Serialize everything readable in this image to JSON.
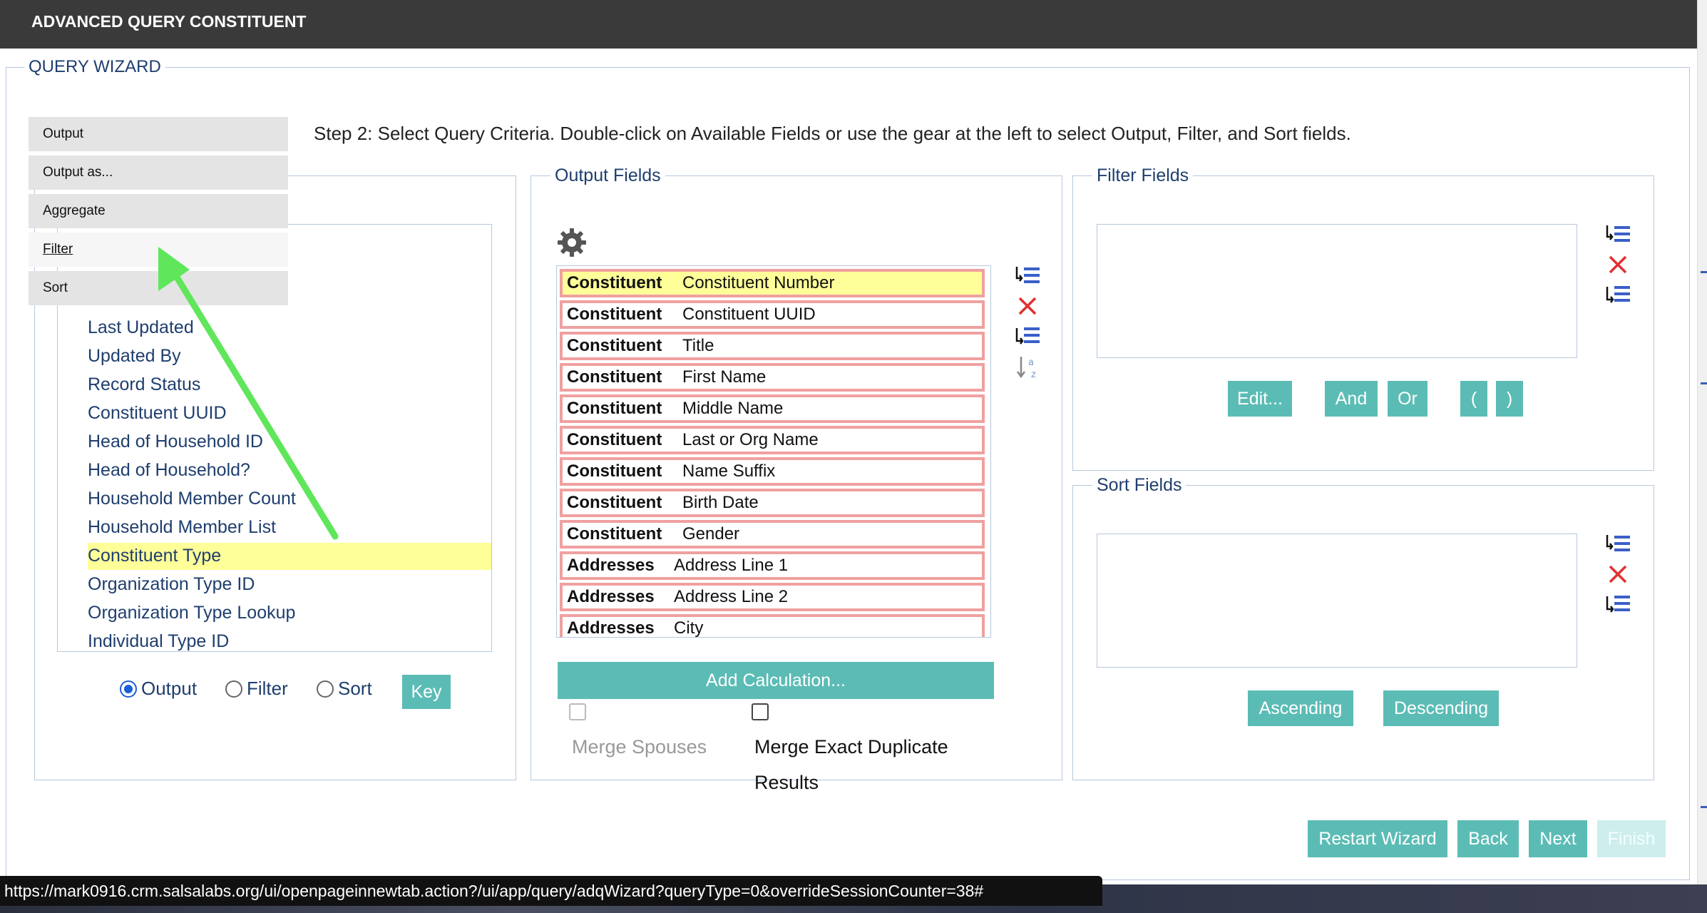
{
  "window": {
    "title": "ADVANCED QUERY CONSTITUENT"
  },
  "wizard": {
    "title": "QUERY WIZARD",
    "step_text": "Step 2: Select Query Criteria. Double-click on Available Fields or use the gear at the left to select Output, Filter, and Sort fields."
  },
  "context_menu": {
    "items": [
      "Output",
      "Output as...",
      "Aggregate",
      "Filter",
      "Sort"
    ],
    "hovered": "Filter"
  },
  "available_fields": {
    "items": [
      "Last Updated",
      "Updated By",
      "Record Status",
      "Constituent UUID",
      "Head of Household ID",
      "Head of Household?",
      "Household Member Count",
      "Household Member List",
      "Constituent Type",
      "Organization Type ID",
      "Organization Type Lookup",
      "Individual Type ID"
    ],
    "selected": "Constituent Type",
    "radio_options": [
      "Output",
      "Filter",
      "Sort"
    ],
    "radio_selected": "Output",
    "key_label": "Key"
  },
  "output_fields": {
    "title": "Output Fields",
    "rows": [
      {
        "category": "Constituent",
        "field": "Constituent Number"
      },
      {
        "category": "Constituent",
        "field": "Constituent UUID"
      },
      {
        "category": "Constituent",
        "field": "Title"
      },
      {
        "category": "Constituent",
        "field": "First Name"
      },
      {
        "category": "Constituent",
        "field": "Middle Name"
      },
      {
        "category": "Constituent",
        "field": "Last or Org Name"
      },
      {
        "category": "Constituent",
        "field": "Name Suffix"
      },
      {
        "category": "Constituent",
        "field": "Birth Date"
      },
      {
        "category": "Constituent",
        "field": "Gender"
      },
      {
        "category": "Addresses",
        "field": "Address Line 1"
      },
      {
        "category": "Addresses",
        "field": "Address Line 2"
      },
      {
        "category": "Addresses",
        "field": "City"
      }
    ],
    "add_calc_label": "Add Calculation...",
    "merge_spouses_label": "Merge Spouses",
    "merge_dupes_label_1": "Merge Exact Duplicate",
    "merge_dupes_label_2": "Results"
  },
  "filter_fields": {
    "title": "Filter Fields",
    "buttons": {
      "edit": "Edit...",
      "and": "And",
      "or": "Or",
      "open_paren": "(",
      "close_paren": ")"
    }
  },
  "sort_fields": {
    "title": "Sort Fields",
    "buttons": {
      "ascending": "Ascending",
      "descending": "Descending"
    }
  },
  "footer": {
    "restart": "Restart Wizard",
    "back": "Back",
    "next": "Next",
    "finish": "Finish"
  },
  "status_url": "https://mark0916.crm.salsalabs.org/ui/openpageinnewtab.action?/ui/app/query/adqWizard?queryType=0&overrideSessionCounter=38#",
  "colors": {
    "accent": "#5bbcb5",
    "highlight": "#ffff99",
    "link": "#1f3e6e",
    "arrow": "#5fe65a",
    "delete": "#e03030"
  },
  "icons": [
    "gear-icon",
    "add-list-icon",
    "delete-x-icon",
    "insert-list-icon",
    "sort-az-icon"
  ]
}
